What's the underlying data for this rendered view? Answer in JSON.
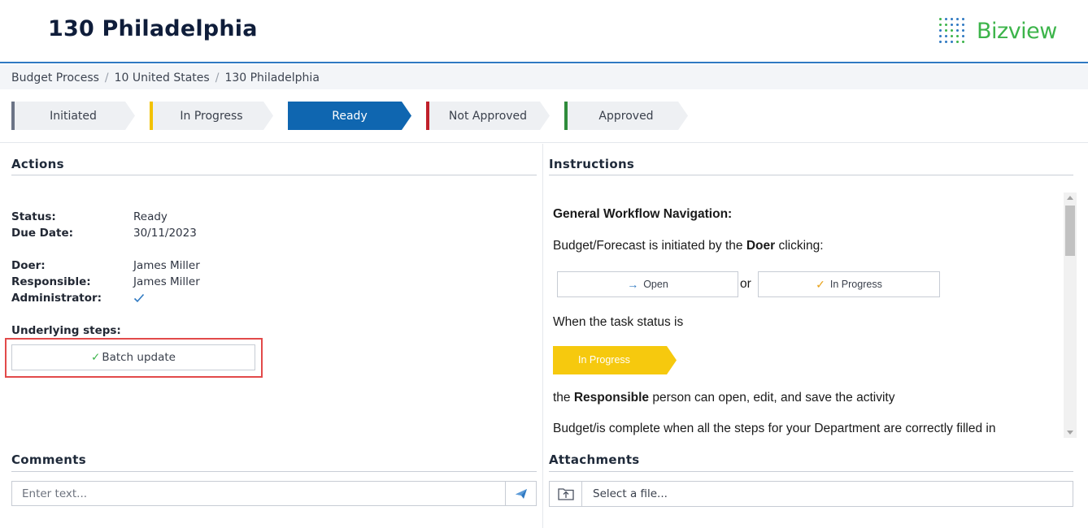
{
  "header": {
    "title": "130 Philadelphia",
    "logo_text": "Bizview",
    "logo_color": "#3cb44a",
    "logo_dot_color": "#2f79c2"
  },
  "breadcrumb": [
    "Budget Process",
    "10 United States",
    "130 Philadelphia"
  ],
  "stages": [
    {
      "label": "Initiated",
      "color": "#6b7486",
      "active": false
    },
    {
      "label": "In Progress",
      "color": "#f2c200",
      "active": false
    },
    {
      "label": "Ready",
      "color": "#0f66b0",
      "active": true
    },
    {
      "label": "Not Approved",
      "color": "#c0202a",
      "active": false
    },
    {
      "label": "Approved",
      "color": "#2e8b3b",
      "active": false
    }
  ],
  "actions": {
    "title": "Actions",
    "status_label": "Status:",
    "status_value": "Ready",
    "due_label": "Due Date:",
    "due_value": "30/11/2023",
    "doer_label": "Doer:",
    "doer_value": "James Miller",
    "responsible_label": "Responsible:",
    "responsible_value": "James Miller",
    "administrator_label": "Administrator:",
    "administrator_icon": "check-icon",
    "underlying_label": "Underlying steps:",
    "batch_button": "Batch update"
  },
  "instructions": {
    "title": "Instructions",
    "heading": "General Workflow Navigation:",
    "line1_prefix": "Budget/Forecast is initiated by the ",
    "line1_bold": "Doer",
    "line1_suffix": " clicking:",
    "open_button": "Open",
    "or_text": "or",
    "in_progress_button": "In Progress",
    "line2": "When the task status is",
    "chip_label": "In Progress",
    "chip_color": "#f6c90e",
    "line3_prefix": "the ",
    "line3_bold": "Responsible",
    "line3_suffix": " person can open, edit, and save the activity",
    "line4": "Budget/is complete when all the steps for your Department are correctly filled in"
  },
  "comments": {
    "title": "Comments",
    "placeholder": "Enter text...",
    "send_icon": "send-icon"
  },
  "attachments": {
    "title": "Attachments",
    "placeholder": "Select a file...",
    "upload_icon": "upload-folder-icon"
  }
}
